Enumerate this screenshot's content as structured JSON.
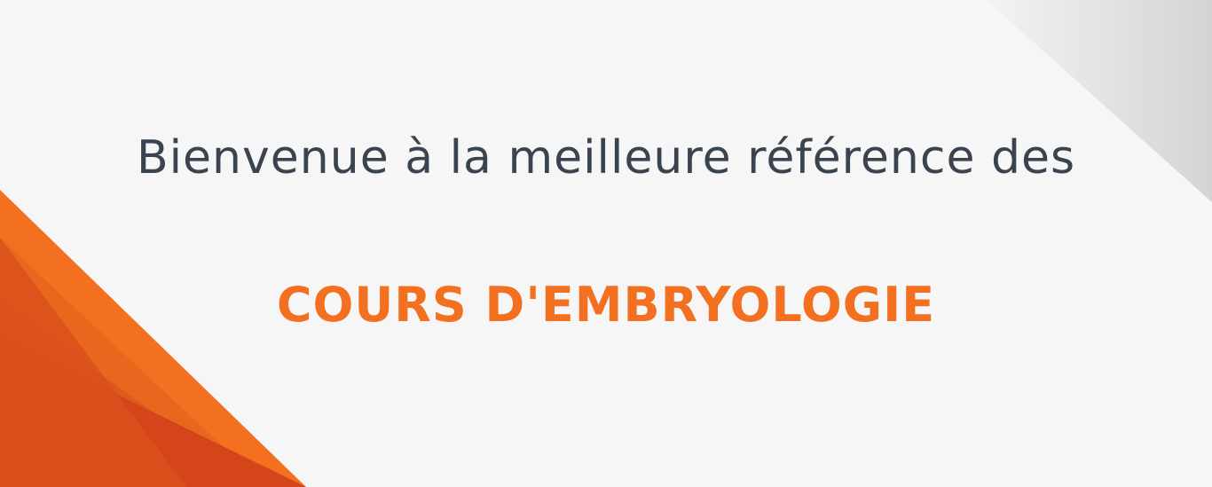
{
  "banner": {
    "headline": "Bienvenue à la meilleure référence des",
    "subject": "COURS D'EMBRYOLOGIE"
  },
  "colors": {
    "background": "#f6f6f6",
    "headline_text": "#3a4450",
    "accent_orange": "#f37021",
    "accent_orange_dark": "#d4451a",
    "accent_orange_mid": "#dd5a1f",
    "corner_gray": "#d9d9d9"
  },
  "icons": [
    "orange-corner-shape",
    "gray-corner-shape"
  ]
}
